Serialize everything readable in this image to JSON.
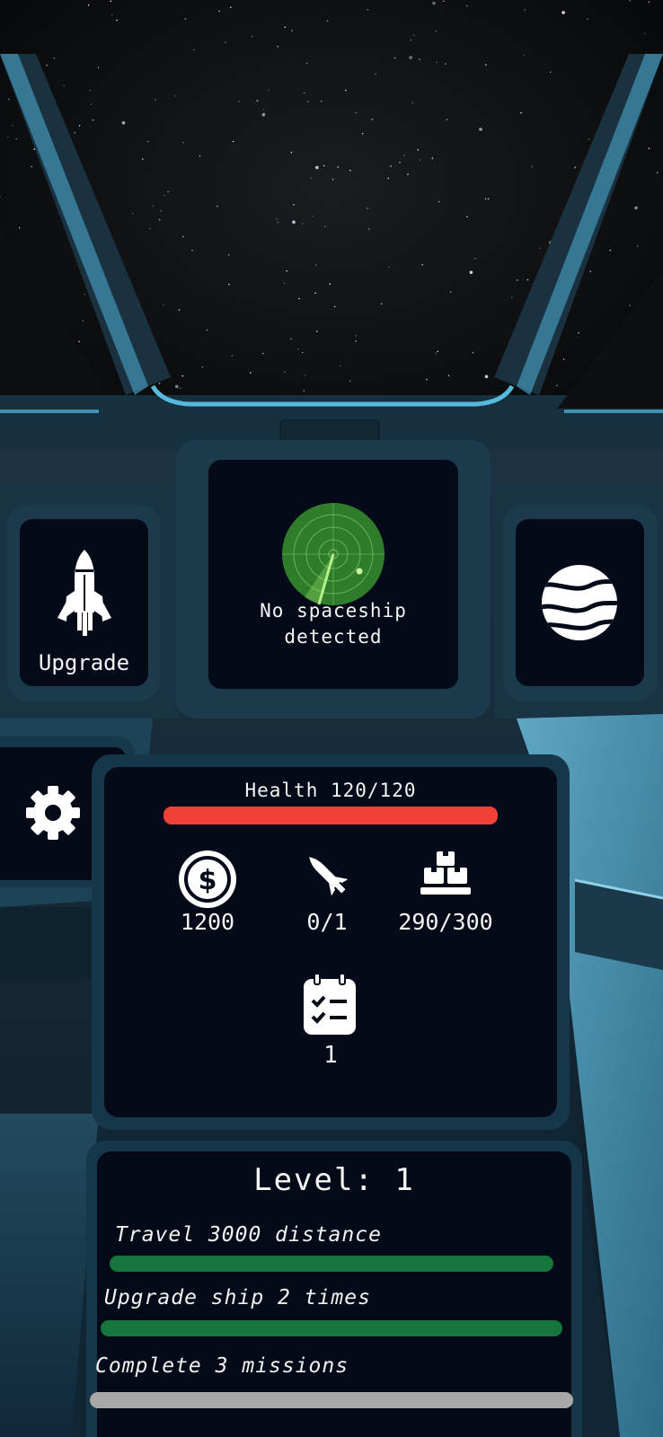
{
  "radar": {
    "status_line1": "No spaceship",
    "status_line2": "detected"
  },
  "left_panel": {
    "icon": "rocket-icon",
    "label": "Upgrade"
  },
  "right_panel": {
    "icon": "planet-icon"
  },
  "settings": {
    "icon": "gear-icon"
  },
  "stats": {
    "health_label": "Health 120/120",
    "health_fraction": 1.0,
    "health_color": "#f04038",
    "credits_icon": "dollar-coin-icon",
    "credits": "1200",
    "missiles_icon": "missile-icon",
    "missiles": "0/1",
    "cargo_icon": "cargo-crates-icon",
    "cargo": "290/300",
    "missions_icon": "clipboard-checklist-icon",
    "missions": "1"
  },
  "level": {
    "title": "Level: 1",
    "objectives": [
      {
        "label": "Travel 3000 distance",
        "progress": 1.0,
        "color": "#15753a"
      },
      {
        "label": "Upgrade ship 2 times",
        "progress": 1.0,
        "color": "#15753a"
      },
      {
        "label": "Complete 3 missions",
        "progress": 0.0,
        "color": "#a8a8a8"
      }
    ]
  }
}
